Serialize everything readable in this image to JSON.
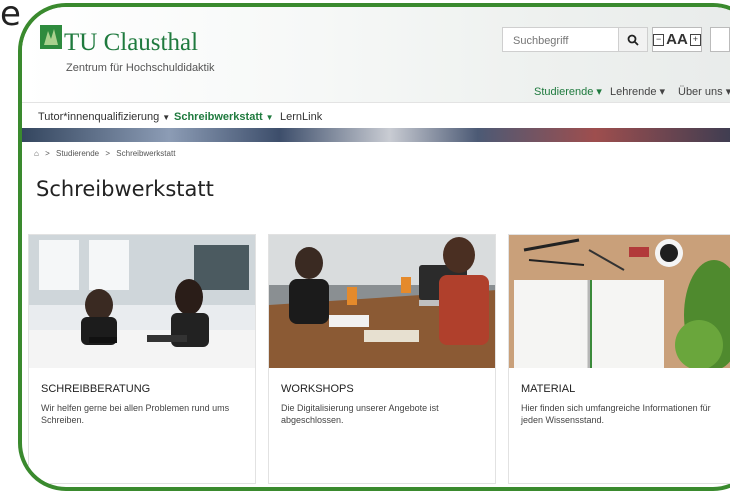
{
  "corner_letter": "e",
  "header": {
    "brand": "TU Clausthal",
    "subtitle": "Zentrum für Hochschuldidaktik",
    "search_placeholder": "Suchbegriff",
    "font_controls": "AA",
    "nav": [
      {
        "label": "Studierende ▾",
        "active": true
      },
      {
        "label": "Lehrende ▾",
        "active": false
      },
      {
        "label": "Über uns ▾",
        "active": false
      }
    ]
  },
  "subnav": [
    {
      "label": "Tutor*innenqualifizierung",
      "active": false
    },
    {
      "label": "Schreibwerkstatt",
      "active": true
    },
    {
      "label": "LernLink",
      "active": false
    }
  ],
  "breadcrumb": {
    "home_icon": "home-icon",
    "sep": ">",
    "items": [
      "Studierende",
      "Schreibwerkstatt"
    ]
  },
  "page": {
    "title": "Schreibwerkstatt"
  },
  "cards": [
    {
      "title": "Schreibberatung",
      "description": "Wir helfen gerne bei allen Problemen rund ums Schreiben."
    },
    {
      "title": "Workshops",
      "description": "Die Digitalisierung unserer Angebote ist abgeschlossen."
    },
    {
      "title": "Material",
      "description": "Hier finden sich umfangreiche Informationen für jeden Wissensstand."
    }
  ],
  "colors": {
    "brand_green": "#1f7a3e",
    "frame_green": "#3a8a2e"
  }
}
